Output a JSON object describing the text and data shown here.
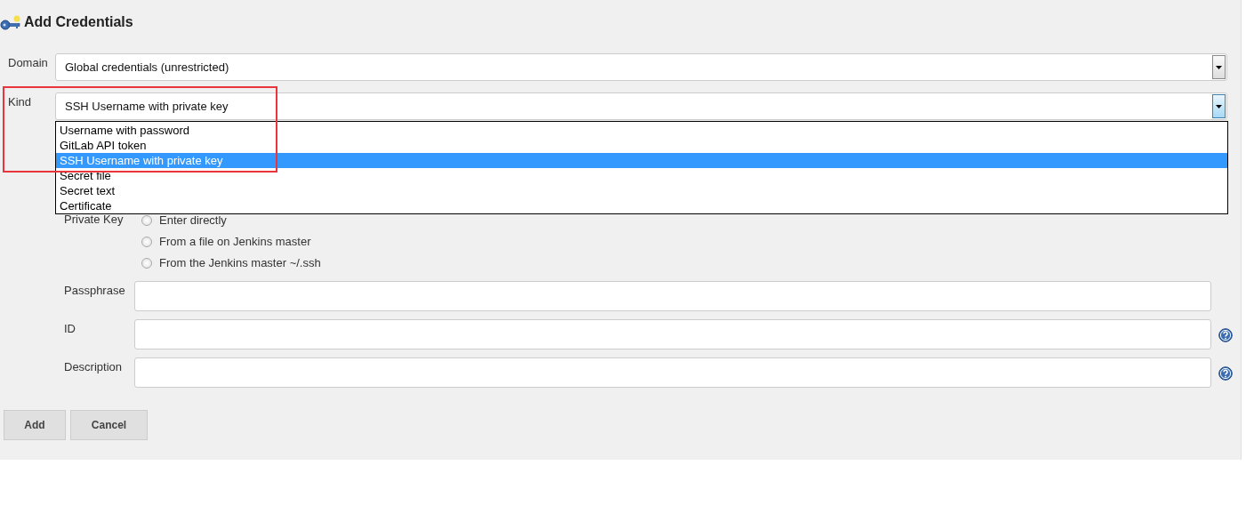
{
  "title": "Add Credentials",
  "selects": [
    {
      "label": "Domain",
      "value": "Global credentials (unrestricted)",
      "focused": false
    },
    {
      "label": "Kind",
      "value": "SSH Username with private key",
      "focused": true
    }
  ],
  "kind_dropdown": {
    "options": [
      {
        "label": "Username with password",
        "selected": false
      },
      {
        "label": "GitLab API token",
        "selected": false
      },
      {
        "label": "SSH Username with private key",
        "selected": true
      },
      {
        "label": "Secret file",
        "selected": false
      },
      {
        "label": "Secret text",
        "selected": false
      },
      {
        "label": "Certificate",
        "selected": false
      }
    ]
  },
  "private_key": {
    "label": "Private Key",
    "options": [
      {
        "label": "Enter directly",
        "selected": false
      },
      {
        "label": "From a file on Jenkins master",
        "selected": false
      },
      {
        "label": "From the Jenkins master ~/.ssh",
        "selected": false
      }
    ]
  },
  "text_fields": [
    {
      "label": "Passphrase",
      "help": false
    },
    {
      "label": "ID",
      "help": true
    },
    {
      "label": "Description",
      "help": true
    }
  ],
  "buttons": [
    "Add",
    "Cancel"
  ]
}
